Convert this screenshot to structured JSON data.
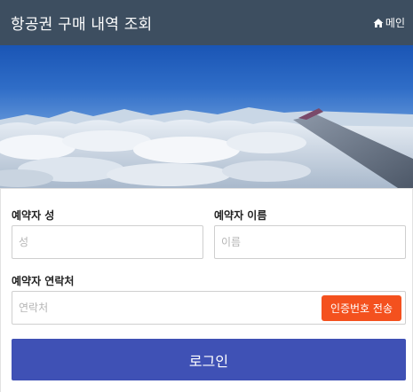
{
  "header": {
    "title": "항공권 구매 내역 조회",
    "home_label": "메인",
    "home_icon": "home-icon",
    "background_color": "#3d4e60"
  },
  "hero": {
    "image": "airplane-wing-above-clouds"
  },
  "form": {
    "last_name": {
      "label": "예약자 성",
      "placeholder": "성",
      "value": ""
    },
    "first_name": {
      "label": "예약자 이름",
      "placeholder": "이름",
      "value": ""
    },
    "contact": {
      "label": "예약자 연락처",
      "placeholder": "연락처",
      "value": ""
    },
    "send_code_label": "인증번호 전송",
    "send_code_color": "#f4511e"
  },
  "login": {
    "label": "로그인",
    "color": "#3f51b5"
  }
}
